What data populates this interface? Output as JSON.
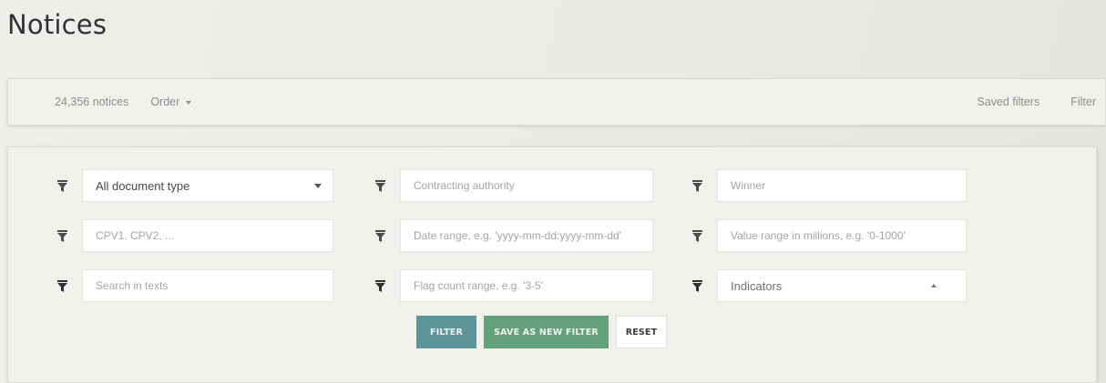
{
  "page": {
    "title": "Notices"
  },
  "toolbar": {
    "count": "24,356 notices",
    "order_label": "Order",
    "saved_filters": "Saved filters",
    "filter_link": "Filter"
  },
  "filters": {
    "document_type": {
      "value": "All document type"
    },
    "contracting_authority": {
      "placeholder": "Contracting authority"
    },
    "winner": {
      "placeholder": "Winner"
    },
    "cpv": {
      "placeholder": "CPV1, CPV2, ..."
    },
    "date_range": {
      "placeholder": "Date range, e.g. 'yyyy-mm-dd:yyyy-mm-dd'"
    },
    "value_range": {
      "placeholder": "Value range in millions, e.g. '0-1000'"
    },
    "search_texts": {
      "placeholder": "Search in texts"
    },
    "flag_count": {
      "placeholder": "Flag count range, e.g. '3-5'"
    },
    "indicators": {
      "value": "Indicators"
    }
  },
  "actions": {
    "filter": "FILTER",
    "save_new": "SAVE AS NEW FILTER",
    "reset": "RESET"
  },
  "colors": {
    "filter_button": "#5e9598",
    "save_button": "#64a17a",
    "funnel_icon": "#4a4c4e"
  }
}
